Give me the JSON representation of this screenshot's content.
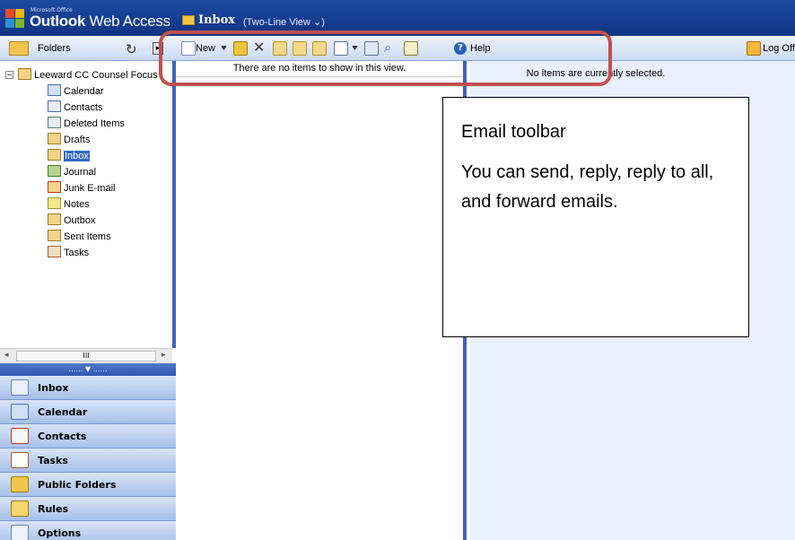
{
  "titlebar": {
    "brand_small": "Microsoft Office",
    "brand_strong": "Outlook",
    "brand_rest": " Web Access",
    "view_title": "Inbox",
    "view_mode": "(Two-Line View ⌄)"
  },
  "folders_pane": {
    "header": "Folders",
    "root": "Leeward CC Counsel Focus",
    "items": [
      {
        "label": "Calendar",
        "icon": "calendar-icon"
      },
      {
        "label": "Contacts",
        "icon": "contacts-icon"
      },
      {
        "label": "Deleted Items",
        "icon": "deleted-items-icon"
      },
      {
        "label": "Drafts",
        "icon": "drafts-icon"
      },
      {
        "label": "Inbox",
        "icon": "inbox-icon",
        "selected": true
      },
      {
        "label": "Journal",
        "icon": "journal-icon"
      },
      {
        "label": "Junk E-mail",
        "icon": "junk-icon"
      },
      {
        "label": "Notes",
        "icon": "notes-icon"
      },
      {
        "label": "Outbox",
        "icon": "outbox-icon"
      },
      {
        "label": "Sent Items",
        "icon": "sent-items-icon"
      },
      {
        "label": "Tasks",
        "icon": "tasks-icon"
      }
    ],
    "scroll_thumb": "III",
    "splitter": "…… ▼ ……"
  },
  "toolbar": {
    "new_label": "New",
    "help_label": "Help",
    "logoff_label": "Log Off"
  },
  "nav_buttons": [
    {
      "label": "Inbox",
      "icon": "inbox-icon"
    },
    {
      "label": "Calendar",
      "icon": "calendar-icon"
    },
    {
      "label": "Contacts",
      "icon": "contacts-icon"
    },
    {
      "label": "Tasks",
      "icon": "tasks-icon"
    },
    {
      "label": "Public Folders",
      "icon": "public-folders-icon"
    },
    {
      "label": "Rules",
      "icon": "rules-icon"
    },
    {
      "label": "Options",
      "icon": "options-icon"
    }
  ],
  "message_list": {
    "empty_text": "There are no items to show in this view."
  },
  "reading_pane": {
    "empty_text": "No items are currently selected."
  },
  "callout": {
    "title": "Email toolbar",
    "body": "You can send, reply, reply to all, and forward emails."
  },
  "colors": {
    "titlebar": "#1d4aa0",
    "annotation": "#c0504d",
    "reading_bg": "#e8f0fd"
  }
}
